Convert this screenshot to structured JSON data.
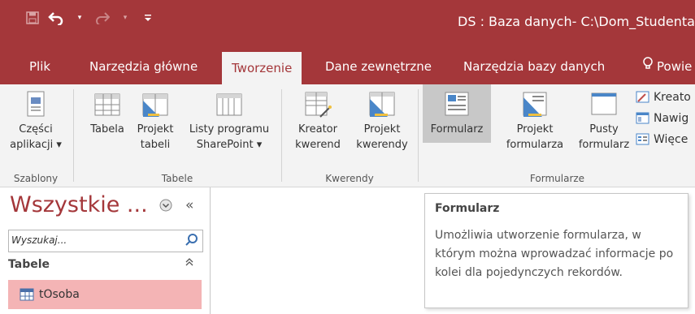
{
  "window": {
    "title": "DS : Baza danych- C:\\Dom_Studenta\\"
  },
  "quick_access": {
    "save_icon": "save-icon",
    "undo_icon": "undo-icon",
    "redo_icon": "redo-icon",
    "customize_icon": "customize-icon"
  },
  "tabs": [
    {
      "label": "Plik"
    },
    {
      "label": "Narzędzia główne"
    },
    {
      "label": "Tworzenie"
    },
    {
      "label": "Dane zewnętrzne"
    },
    {
      "label": "Narzędzia bazy danych"
    },
    {
      "label": "Powie"
    }
  ],
  "ribbon": {
    "groups": {
      "szablony": {
        "label": "Szablony"
      },
      "tabele": {
        "label": "Tabele"
      },
      "kwerendy": {
        "label": "Kwerendy"
      },
      "formularze": {
        "label": "Formularze"
      }
    },
    "buttons": {
      "czesci_line1": "Części",
      "czesci_line2": "aplikacji ▾",
      "tabela": "Tabela",
      "projekt_tabeli_line1": "Projekt",
      "projekt_tabeli_line2": "tabeli",
      "listy_line1": "Listy programu",
      "listy_line2": "SharePoint ▾",
      "kreator_kwerend_line1": "Kreator",
      "kreator_kwerend_line2": "kwerend",
      "projekt_kwerendy_line1": "Projekt",
      "projekt_kwerendy_line2": "kwerendy",
      "formularz": "Formularz",
      "projekt_formularza_line1": "Projekt",
      "projekt_formularza_line2": "formularza",
      "pusty_formularz_line1": "Pusty",
      "pusty_formularz_line2": "formularz",
      "kreator_small": "Kreato",
      "nawigacja_small": "Nawig",
      "wiecej_small": "Więce"
    }
  },
  "nav_pane": {
    "header": "Wszystkie ...",
    "search_placeholder": "Wyszukaj...",
    "category": "Tabele",
    "items": [
      {
        "label": "tOsoba"
      }
    ]
  },
  "tooltip": {
    "title": "Formularz",
    "body": "Umożliwia utworzenie formularza, w którym można wprowadzać informacje po kolei dla pojedynczych rekordów."
  },
  "colors": {
    "accent": "#a4373a",
    "ribbon_bg": "#f3f3f3",
    "selected_item": "#f4b4b5"
  }
}
